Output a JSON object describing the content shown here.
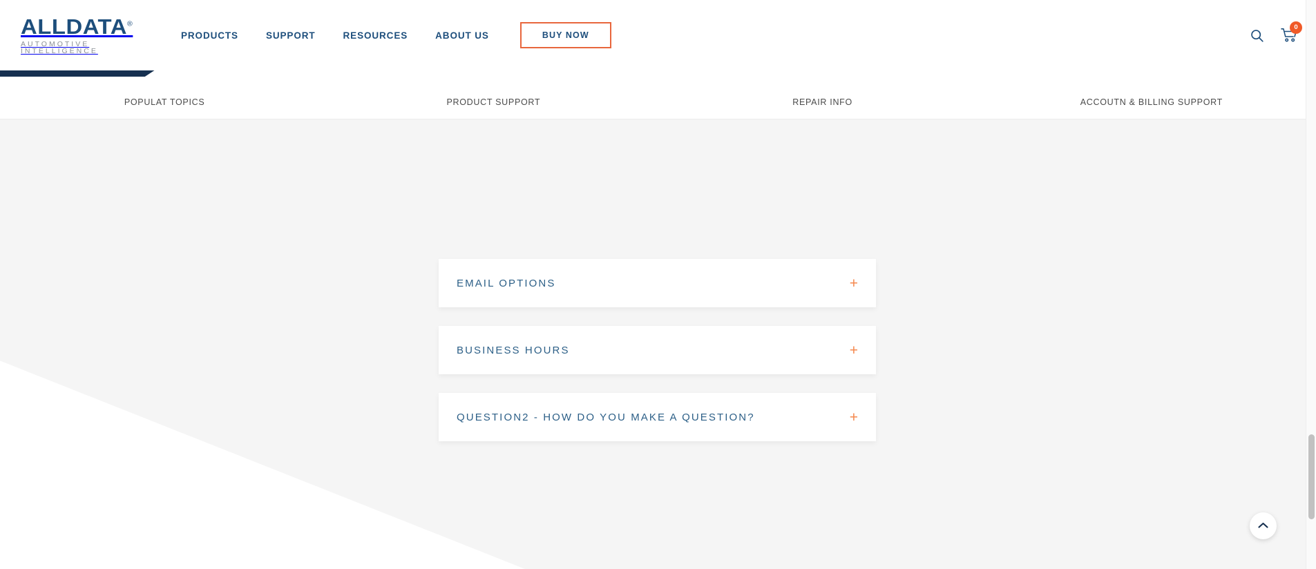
{
  "header": {
    "logo": {
      "wordmark": "ALLDATA",
      "registered": "®",
      "tagline": "AUTOMOTIVE INTELLIGENCE"
    },
    "nav": [
      {
        "label": "PRODUCTS"
      },
      {
        "label": "SUPPORT"
      },
      {
        "label": "RESOURCES"
      },
      {
        "label": "ABOUT US"
      }
    ],
    "buy_now_label": "BUY NOW",
    "search_icon": "search-icon",
    "cart_icon": "shopping-cart-icon",
    "cart_count": "0"
  },
  "subnav": {
    "items": [
      {
        "label": "POPULAT TOPICS"
      },
      {
        "label": "PRODUCT SUPPORT"
      },
      {
        "label": "REPAIR INFO"
      },
      {
        "label": "ACCOUTN & BILLING SUPPORT"
      }
    ]
  },
  "main": {
    "accordion": [
      {
        "title": "EMAIL OPTIONS",
        "toggle": "+"
      },
      {
        "title": "BUSINESS HOURS",
        "toggle": "+"
      },
      {
        "title": "QUESTION2 - HOW DO YOU MAKE A QUESTION?",
        "toggle": "+"
      }
    ]
  },
  "scroll_top": {
    "icon": "chevron-up-icon"
  },
  "colors": {
    "brand_navy": "#1d4e7c",
    "dark_navy": "#163050",
    "accent_orange": "#e8663c",
    "plus_orange": "#f5884e",
    "badge_orange": "#f05a28",
    "accordion_title": "#2c5f87",
    "page_bg": "#f5f5f5"
  }
}
